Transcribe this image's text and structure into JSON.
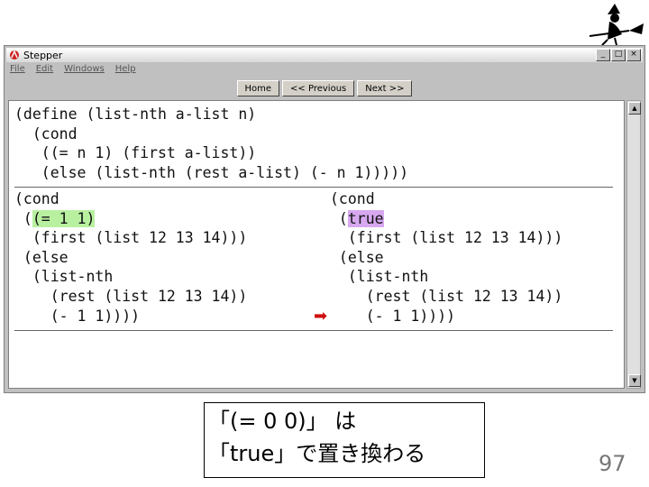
{
  "window": {
    "title": "Stepper"
  },
  "menu": [
    "File",
    "Edit",
    "Windows",
    "Help"
  ],
  "toolbar": {
    "home": "Home",
    "previous": "<< Previous",
    "next": "Next >>"
  },
  "definition": [
    "(define (list-nth a-list n)",
    "  (cond",
    "   ((= n 1) (first a-list))",
    "   (else (list-nth (rest a-list) (- n 1)))))"
  ],
  "before": {
    "l1": "(cond",
    "l2_pre": " (",
    "l2_hl": "(= 1 1)",
    "l3": "  (first (list 12 13 14)))",
    "l4": " (else",
    "l5": "  (list-nth",
    "l6": "    (rest (list 12 13 14))",
    "l7": "    (- 1 1))))"
  },
  "after": {
    "l1": "(cond",
    "l2_pre": " (",
    "l2_hl": "true",
    "l3": "  (first (list 12 13 14)))",
    "l4": " (else",
    "l5": "  (list-nth",
    "l6": "    (rest (list 12 13 14))",
    "l7": "    (- 1 1))))"
  },
  "arrow_glyph": "➡",
  "caption": {
    "line1": "「(= 0 0)」 は",
    "line2": "「true」で置き換わる"
  },
  "page_number": "97",
  "colors": {
    "highlight_before": "#b8f0a0",
    "highlight_after": "#d7a8f0",
    "arrow": "#d01010"
  }
}
